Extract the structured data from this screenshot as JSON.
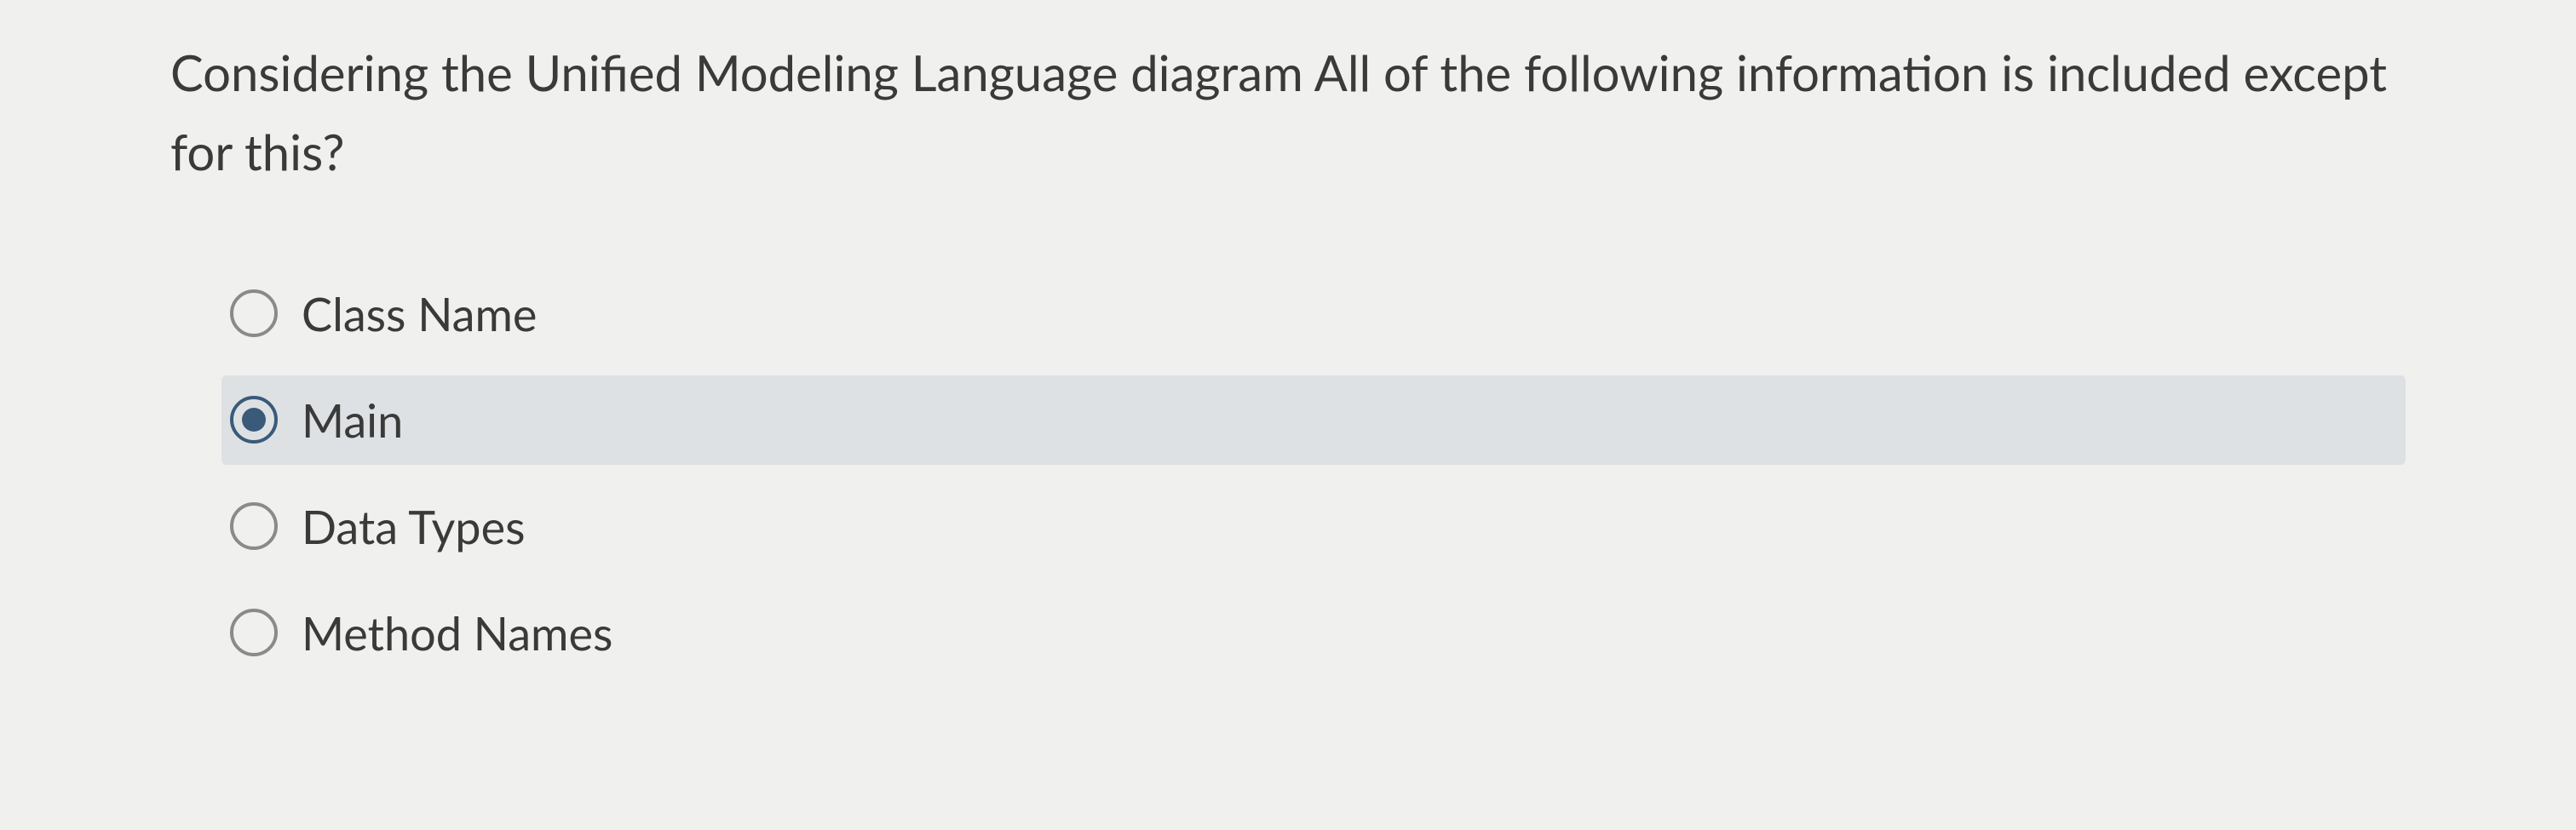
{
  "question": {
    "text": "Considering the Unified Modeling Language diagram All of the following information is included except for this?"
  },
  "options": [
    {
      "label": "Class Name",
      "selected": false
    },
    {
      "label": "Main",
      "selected": true
    },
    {
      "label": "Data Types",
      "selected": false
    },
    {
      "label": "Method Names",
      "selected": false
    }
  ]
}
